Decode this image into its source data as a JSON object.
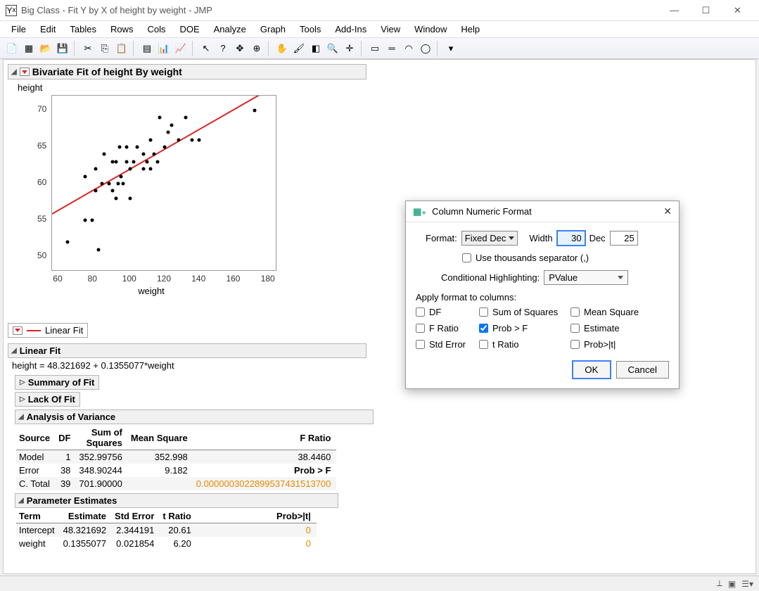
{
  "window": {
    "title": "Big Class - Fit Y by X of height by weight - JMP"
  },
  "menu": [
    "File",
    "Edit",
    "Tables",
    "Rows",
    "Cols",
    "DOE",
    "Analyze",
    "Graph",
    "Tools",
    "Add-Ins",
    "View",
    "Window",
    "Help"
  ],
  "report": {
    "title": "Bivariate Fit of height By weight",
    "y_axis": "height",
    "x_axis": "weight",
    "y_ticks": [
      50,
      55,
      60,
      65,
      70
    ],
    "x_ticks": [
      60,
      80,
      100,
      120,
      140,
      160,
      180
    ],
    "y_range": [
      48,
      72
    ],
    "x_range": [
      55,
      185
    ],
    "legend": "Linear Fit",
    "linear_fit_head": "Linear Fit",
    "equation": "height = 48.321692 + 0.1355077*weight",
    "summary_head": "Summary of Fit",
    "lack_head": "Lack Of Fit",
    "anova_head": "Analysis of Variance",
    "anova": {
      "cols": {
        "source": "Source",
        "df": "DF",
        "ss_top": "Sum of",
        "ss_bot": "Squares",
        "ms": "Mean Square",
        "f": "F Ratio"
      },
      "rows": [
        {
          "source": "Model",
          "df": "1",
          "ss": "352.99756",
          "ms": "352.998",
          "f": "38.4460"
        },
        {
          "source": "Error",
          "df": "38",
          "ss": "348.90244",
          "ms": "9.182",
          "extra_label": "Prob > F"
        },
        {
          "source": "C. Total",
          "df": "39",
          "ss": "701.90000",
          "extra_val": "0.0000003022899537431513700"
        }
      ]
    },
    "param_head": "Parameter Estimates",
    "params": {
      "cols": {
        "term": "Term",
        "est": "Estimate",
        "se": "Std Error",
        "t": "t Ratio",
        "p": "Prob>|t|"
      },
      "rows": [
        {
          "term": "Intercept",
          "est": "48.321692",
          "se": "2.344191",
          "t": "20.61",
          "p": "0"
        },
        {
          "term": "weight",
          "est": "0.1355077",
          "se": "0.021854",
          "t": "6.20",
          "p": "0"
        }
      ]
    }
  },
  "chart_data": {
    "type": "scatter",
    "title": "Bivariate Fit of height By weight",
    "xlabel": "weight",
    "ylabel": "height",
    "xlim": [
      55,
      185
    ],
    "ylim": [
      48,
      72
    ],
    "x_ticks": [
      60,
      80,
      100,
      120,
      140,
      160,
      180
    ],
    "y_ticks": [
      50,
      55,
      60,
      65,
      70
    ],
    "series": [
      {
        "name": "observations",
        "type": "scatter",
        "points": [
          [
            64,
            52
          ],
          [
            74,
            55
          ],
          [
            74,
            61
          ],
          [
            78,
            55
          ],
          [
            80,
            59
          ],
          [
            80,
            62
          ],
          [
            82,
            51
          ],
          [
            84,
            60
          ],
          [
            85,
            64
          ],
          [
            88,
            60
          ],
          [
            90,
            59
          ],
          [
            90,
            63
          ],
          [
            92,
            58
          ],
          [
            92,
            63
          ],
          [
            93,
            60
          ],
          [
            94,
            65
          ],
          [
            95,
            61
          ],
          [
            96,
            60
          ],
          [
            98,
            63
          ],
          [
            98,
            65
          ],
          [
            100,
            62
          ],
          [
            100,
            58
          ],
          [
            102,
            63
          ],
          [
            104,
            65
          ],
          [
            108,
            62
          ],
          [
            108,
            64
          ],
          [
            110,
            63
          ],
          [
            112,
            66
          ],
          [
            112,
            62
          ],
          [
            114,
            64
          ],
          [
            116,
            63
          ],
          [
            117,
            69
          ],
          [
            120,
            65
          ],
          [
            122,
            67
          ],
          [
            124,
            68
          ],
          [
            128,
            66
          ],
          [
            132,
            69
          ],
          [
            136,
            66
          ],
          [
            140,
            66
          ],
          [
            172,
            70
          ]
        ]
      },
      {
        "name": "Linear Fit",
        "type": "line",
        "equation": "y = 48.321692 + 0.1355077*x",
        "range": [
          55,
          185
        ]
      }
    ]
  },
  "dialog": {
    "title": "Column Numeric Format",
    "format_label": "Format:",
    "format_value": "Fixed Dec",
    "width_label": "Width",
    "width_value": "30",
    "dec_label": "Dec",
    "dec_value": "25",
    "thousands": "Use thousands separator (,)",
    "cond_label": "Conditional Highlighting:",
    "cond_value": "PValue",
    "apply_label": "Apply format to columns:",
    "checks": [
      {
        "label": "DF",
        "checked": false
      },
      {
        "label": "Sum of Squares",
        "checked": false
      },
      {
        "label": "Mean Square",
        "checked": false
      },
      {
        "label": "F Ratio",
        "checked": false
      },
      {
        "label": "Prob > F",
        "checked": true
      },
      {
        "label": "Estimate",
        "checked": false
      },
      {
        "label": "Std Error",
        "checked": false
      },
      {
        "label": "t Ratio",
        "checked": false
      },
      {
        "label": "Prob>|t|",
        "checked": false
      }
    ],
    "ok": "OK",
    "cancel": "Cancel"
  }
}
